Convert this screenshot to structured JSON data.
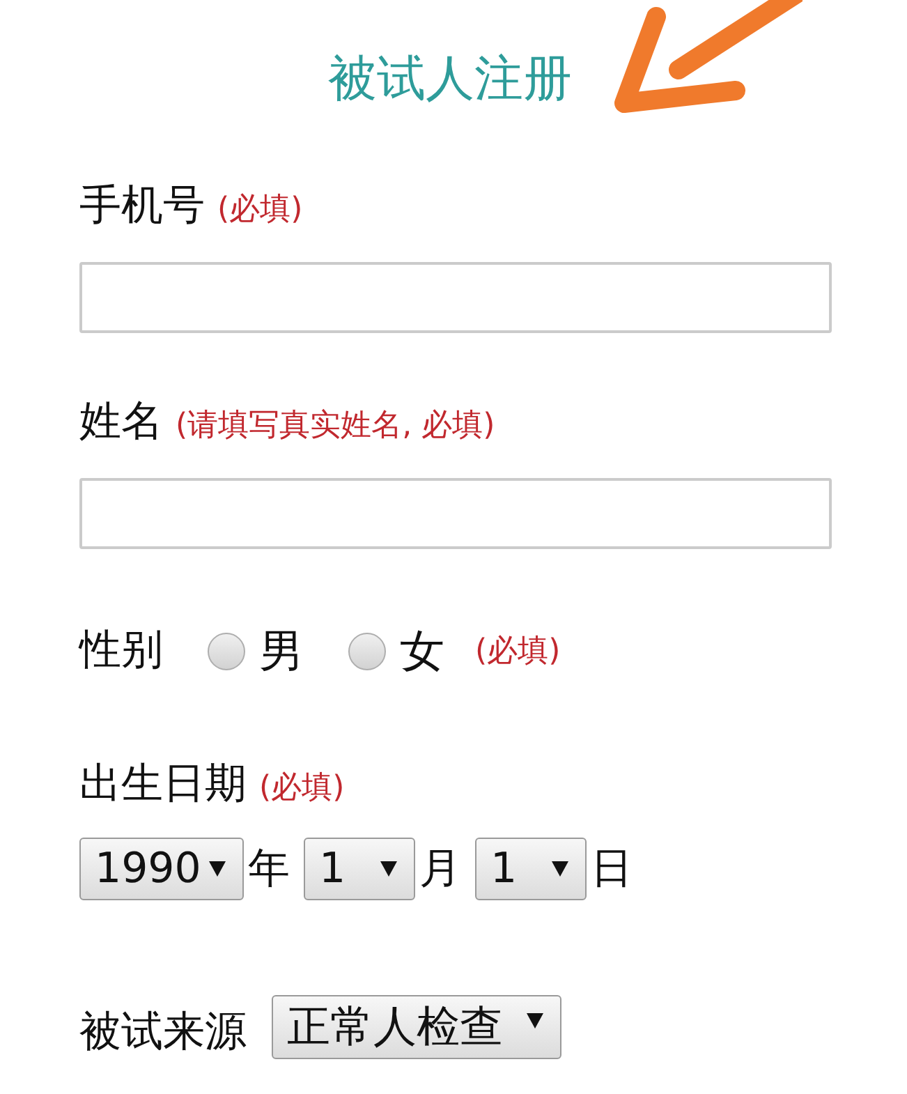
{
  "page": {
    "title": "被试人注册"
  },
  "fields": [
    {
      "kind": "text",
      "label": "手机号",
      "note": "(必填)"
    },
    {
      "kind": "text",
      "label": "姓名",
      "note": "(请填写真实姓名, 必填)"
    },
    {
      "kind": "radio",
      "label": "性别",
      "options": [
        {
          "label": "男",
          "selected": false
        },
        {
          "label": "女",
          "selected": false
        }
      ],
      "note": "(必填)"
    },
    {
      "kind": "date",
      "label": "出生日期",
      "note": "(必填)",
      "parts": [
        {
          "value": "1990",
          "unit": "年"
        },
        {
          "value": "1",
          "unit": "月"
        },
        {
          "value": "1",
          "unit": "日"
        }
      ]
    },
    {
      "kind": "select",
      "label": "被试来源",
      "value": "正常人检查"
    }
  ]
}
